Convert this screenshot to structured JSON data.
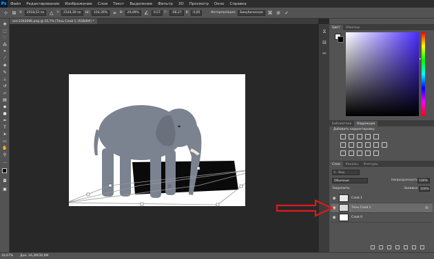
{
  "app": {
    "logo": "Ps"
  },
  "menu": [
    "Файл",
    "Редактирование",
    "Изображение",
    "Слои",
    "Текст",
    "Выделение",
    "Фильтр",
    "3D",
    "Просмотр",
    "Окно",
    "Справка"
  ],
  "options": {
    "x_label": "X:",
    "x_value": "2018,52 пк",
    "y_label": "Y:",
    "y_value": "2144,30 пк",
    "w_label": "Ш:",
    "w_value": "104,39%",
    "h_label": "В:",
    "h_value": "29,09%",
    "angle_value": "0,57",
    "hskew_label": "Г:",
    "hskew_value": "-68,27",
    "vskew_label": "В:",
    "vskew_value": "0,00",
    "interp_label": "Интерполяция:",
    "interp_value": "Бикубическая"
  },
  "document_tab": "ant-2362696.png @ 16,7% (Тень Слой 1, RGB/8#) *",
  "status": {
    "zoom": "16,67%",
    "doc_size": "Док: 26,3М/30,8М"
  },
  "color_panel": {
    "tabs": [
      "Цвет",
      "Образцы"
    ],
    "active_tab": 0,
    "picker_hue": "#4a2cff"
  },
  "adjustments_panel": {
    "tabs": [
      "Библиотеки",
      "Коррекция"
    ],
    "active_tab": 1,
    "title": "Добавить корректировку"
  },
  "layers_panel": {
    "tabs": [
      "Слои",
      "Каналы",
      "Контуры"
    ],
    "active_tab": 0,
    "search_placeholder": "Вид",
    "blend_mode": "Обычные",
    "opacity_label": "Непрозрачность:",
    "opacity_value": "100%",
    "lock_label": "Закрепить:",
    "fill_label": "Заливка:",
    "fill_value": "100%",
    "layers": [
      {
        "name": "Слой 1",
        "selected": false,
        "thumb": "elephant"
      },
      {
        "name": "Тень Слой 1",
        "selected": true,
        "thumb": "shadow"
      },
      {
        "name": "Слой 0",
        "selected": false,
        "thumb": "white"
      }
    ]
  },
  "colors": {
    "annotation_arrow": "#e0191e",
    "selection_row": "#6b6b6b"
  }
}
